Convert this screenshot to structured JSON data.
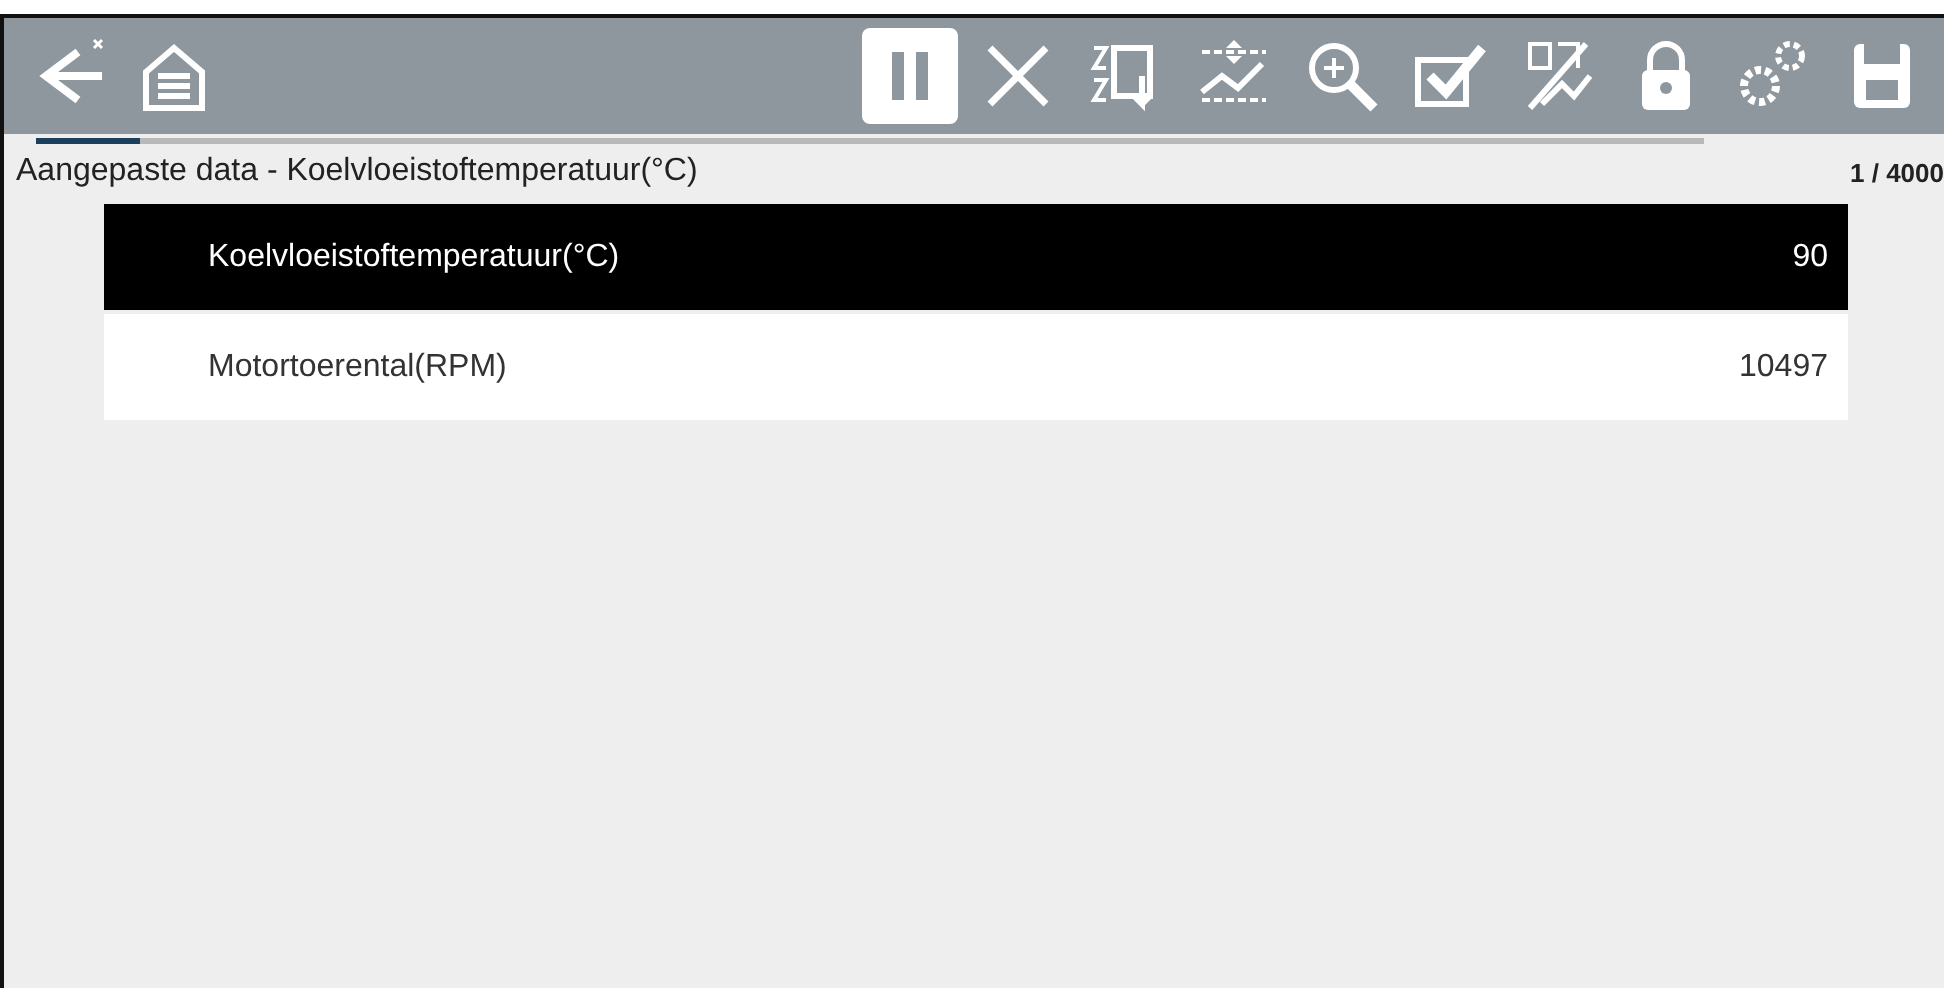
{
  "toolbar": {
    "buttons": [
      {
        "kind": "back",
        "selected": false
      },
      {
        "kind": "home",
        "selected": false
      },
      {
        "kind": "pause",
        "selected": true
      },
      {
        "kind": "clear",
        "selected": false
      },
      {
        "kind": "sort",
        "selected": false
      },
      {
        "kind": "limits",
        "selected": false
      },
      {
        "kind": "zoom",
        "selected": false
      },
      {
        "kind": "select",
        "selected": false
      },
      {
        "kind": "pid",
        "selected": false
      },
      {
        "kind": "lock",
        "selected": false
      },
      {
        "kind": "settings",
        "selected": false
      },
      {
        "kind": "save",
        "selected": false
      }
    ]
  },
  "progress": {
    "level": 0.062
  },
  "title": "Aangepaste data - Koelvloeistoftemperatuur(°C)",
  "counter": "1 / 4000",
  "rows": [
    {
      "name": "Koelvloeistoftemperatuur(°C)",
      "value": "90",
      "selected": true
    },
    {
      "name": "Motortoerental(RPM)",
      "value": "10497",
      "selected": false
    }
  ]
}
